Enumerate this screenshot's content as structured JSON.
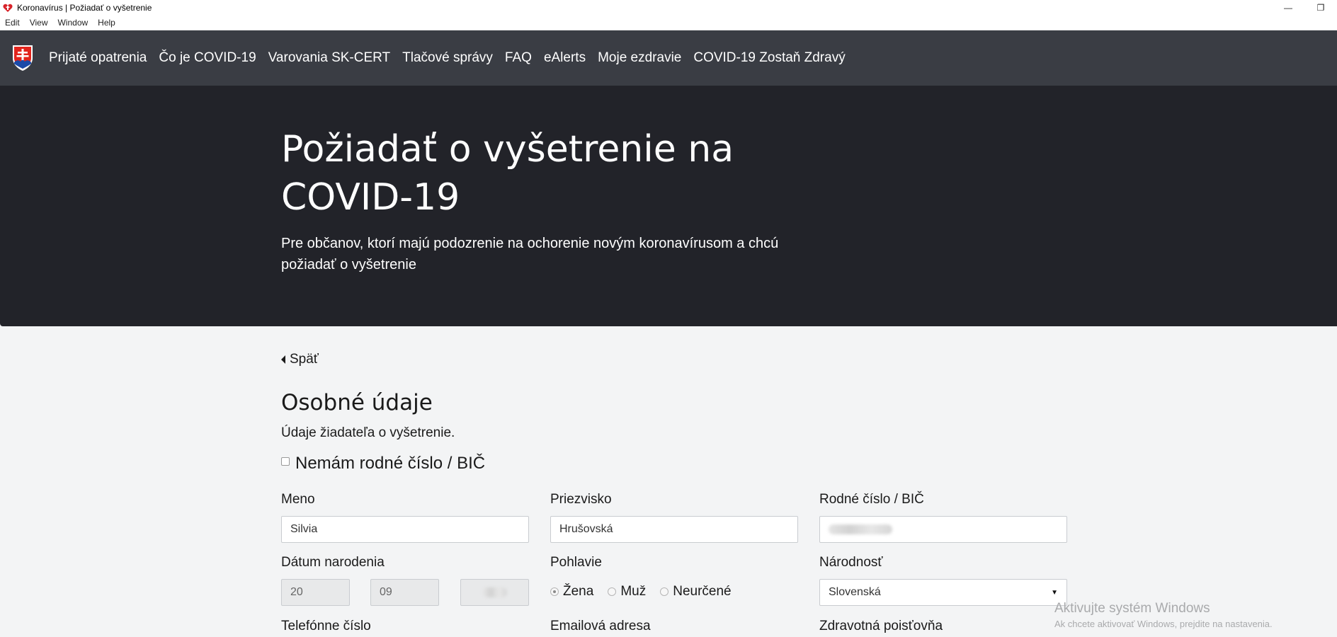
{
  "window": {
    "title": "Koronavírus | Požiadať o vyšetrenie",
    "minimize_glyph": "—",
    "restore_glyph": "❐"
  },
  "menubar": [
    "Edit",
    "View",
    "Window",
    "Help"
  ],
  "nav": {
    "links": [
      "Prijaté opatrenia",
      "Čo je COVID-19",
      "Varovania SK-CERT",
      "Tlačové správy",
      "FAQ",
      "eAlerts",
      "Moje ezdravie",
      "COVID-19 Zostaň Zdravý"
    ],
    "logo_icon": "slovak-coat-of-arms-icon"
  },
  "hero": {
    "title": "Požiadať o vyšetrenie na COVID-19",
    "subtitle": "Pre občanov, ktorí majú podozrenie na ochorenie novým koronavírusom a chcú požiadať o vyšetrenie"
  },
  "form": {
    "back_label": "Späť",
    "section_title": "Osobné údaje",
    "section_subtitle": "Údaje žiadateľa o vyšetrenie.",
    "no_bic_label": "Nemám rodné číslo / BIČ",
    "first_name": {
      "label": "Meno",
      "value": "Silvia"
    },
    "last_name": {
      "label": "Priezvisko",
      "value": "Hrušovská"
    },
    "birth_number": {
      "label": "Rodné číslo / BIČ"
    },
    "birth_date": {
      "label": "Dátum narodenia",
      "day": "20",
      "month": "09"
    },
    "gender": {
      "label": "Pohlavie",
      "options": [
        "Žena",
        "Muž",
        "Neurčené"
      ],
      "selected": "Žena"
    },
    "nationality": {
      "label": "Národnosť",
      "value": "Slovenská"
    },
    "phone": {
      "label": "Telefónne číslo"
    },
    "email": {
      "label": "Emailová adresa"
    },
    "insurance": {
      "label": "Zdravotná poisťovňa"
    }
  },
  "watermark": {
    "title": "Aktivujte systém Windows",
    "subtitle": "Ak chcete aktivovať Windows, prejdite na nastavenia."
  },
  "colors": {
    "navbar": "#3a3d44",
    "hero": "#222329",
    "page_bg": "#f3f4f5"
  }
}
